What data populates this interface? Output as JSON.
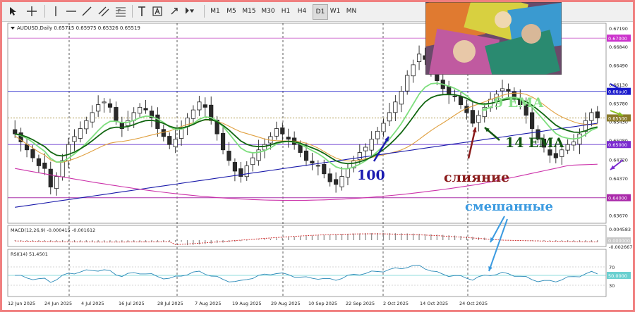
{
  "toolbar": {
    "timeframes": [
      "M1",
      "M5",
      "M15",
      "M30",
      "H1",
      "H4",
      "D1",
      "W1",
      "MN"
    ],
    "active_timeframe": "D1"
  },
  "chart_info": {
    "header": "AUDUSD,Daily  0.65715 0.65975 0.65326 0.65519"
  },
  "price_axis": {
    "ticks": [
      "0.67190",
      "0.66840",
      "0.66490",
      "0.66130",
      "0.65780",
      "0.65430",
      "0.65080",
      "0.64720",
      "0.64370",
      "0.63670"
    ],
    "tags": [
      {
        "text": "0.67000",
        "bg": "#cc33cc",
        "fg": "#ffffff"
      },
      {
        "text": "0.66000",
        "bg": "#1a1acc",
        "fg": "#ffffff"
      },
      {
        "text": "0.65500",
        "bg": "#8a7a2a",
        "fg": "#ffffff"
      },
      {
        "text": "0.65000",
        "bg": "#7a2ad0",
        "fg": "#ffffff"
      },
      {
        "text": "0.64000",
        "bg": "#aa2aaa",
        "fg": "#ffffff"
      }
    ]
  },
  "date_axis": [
    "12 Jun 2025",
    "24 Jun 2025",
    "4 Jul 2025",
    "16 Jul 2025",
    "28 Jul 2025",
    "7 Aug 2025",
    "19 Aug 2025",
    "29 Aug 2025",
    "10 Sep 2025",
    "22 Sep 2025",
    "2 Oct 2025",
    "14 Oct 2025",
    "24 Oct 2025"
  ],
  "macd": {
    "label": "MACD(12,26,9) -0.000415 -0.001612",
    "ticks": [
      "0.004583",
      "0.000000",
      "-0.002667"
    ]
  },
  "rsi": {
    "label": "RSI(14) 51.4501",
    "ticks": [
      "70",
      "50.0000",
      "30"
    ]
  },
  "annotations": {
    "ema9": "9 EMA",
    "ema14": "14 EMA",
    "ma100": "100",
    "merge": "слияние",
    "mixed": "смешанные"
  },
  "chart_data": {
    "type": "candlestick",
    "symbol": "AUDUSD",
    "timeframe": "Daily",
    "ohlc_last": {
      "open": 0.65715,
      "high": 0.65975,
      "low": 0.65326,
      "close": 0.65519
    },
    "ylim": [
      0.6352,
      0.6728
    ],
    "series": [
      {
        "name": "9 EMA"
      },
      {
        "name": "14 EMA"
      },
      {
        "name": "100"
      }
    ],
    "levels": [
      0.67,
      0.66,
      0.655,
      0.65,
      0.64
    ],
    "closes": [
      0.652,
      0.6505,
      0.649,
      0.6475,
      0.646,
      0.6455,
      0.642,
      0.644,
      0.647,
      0.65,
      0.6515,
      0.653,
      0.6545,
      0.656,
      0.6575,
      0.658,
      0.657,
      0.6545,
      0.653,
      0.6545,
      0.656,
      0.657,
      0.6565,
      0.655,
      0.653,
      0.6515,
      0.65,
      0.651,
      0.653,
      0.655,
      0.6565,
      0.658,
      0.657,
      0.6545,
      0.652,
      0.649,
      0.647,
      0.645,
      0.644,
      0.646,
      0.6475,
      0.649,
      0.65,
      0.6515,
      0.653,
      0.652,
      0.651,
      0.65,
      0.6485,
      0.647,
      0.6465,
      0.646,
      0.6445,
      0.643,
      0.6425,
      0.644,
      0.6455,
      0.647,
      0.6485,
      0.6495,
      0.651,
      0.6525,
      0.654,
      0.656,
      0.658,
      0.66,
      0.663,
      0.665,
      0.667,
      0.666,
      0.664,
      0.662,
      0.6605,
      0.6595,
      0.659,
      0.6575,
      0.656,
      0.654,
      0.6555,
      0.657,
      0.6585,
      0.6595,
      0.6605,
      0.66,
      0.659,
      0.6575,
      0.6555,
      0.653,
      0.651,
      0.6495,
      0.648,
      0.6475,
      0.649,
      0.65,
      0.6505,
      0.652,
      0.6545,
      0.656,
      0.655
    ]
  },
  "colors": {
    "ema9": "#7dde7d",
    "ema14": "#116611",
    "ma100": "#1a1aaa",
    "orange_ma": "#e0a040",
    "magenta_ma": "#cc33aa",
    "bull": "#ffffff",
    "bear": "#2a2a2a"
  }
}
